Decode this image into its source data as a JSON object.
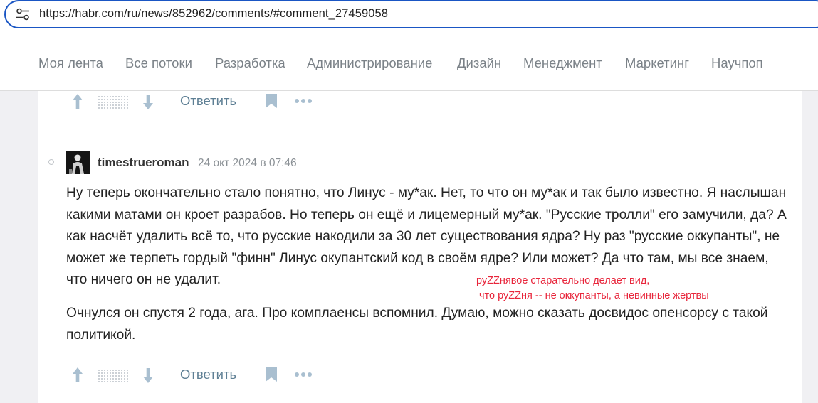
{
  "browser": {
    "url": "https://habr.com/ru/news/852962/comments/#comment_27459058",
    "site_info_icon": "tune-icon"
  },
  "nav": {
    "items": [
      {
        "label": "Моя лента"
      },
      {
        "label": "Все потоки"
      },
      {
        "label": "Разработка"
      },
      {
        "label": "Администрирование"
      },
      {
        "label": "Дизайн"
      },
      {
        "label": "Менеджмент"
      },
      {
        "label": "Маркетинг"
      },
      {
        "label": "Научпоп"
      }
    ]
  },
  "prev_comment_actions": {
    "reply_label": "Ответить",
    "icons": [
      "arrow-up-icon",
      "score-placeholder",
      "arrow-down-icon",
      "bookmark-icon",
      "more-icon"
    ]
  },
  "comment": {
    "author": "timestrueroman",
    "timestamp": "24 окт 2024 в 07:46",
    "paragraph1": "Ну теперь окончательно стало понятно, что Линус - му*ак. Нет, то что он му*ак и так было известно. Я наслышан какими матами он кроет разрабов. Но теперь он ещё и лицемерный му*ак. \"Русские тролли\" его замучили, да? А как насчёт удалить всё то, что русские накодили за 30 лет существования ядра? Ну раз \"русские оккупанты\", не может же терпеть гордый \"финн\" Линус окупантский код в своём ядре? Или может? Да что там, мы все знаем, что ничего он не удалит.",
    "paragraph2": "Очнулся он спустя 2 года, ага. Про комплаенсы вспомнил. Думаю, можно сказать досвидос опенсорсу с такой политикой.",
    "actions": {
      "reply_label": "Ответить"
    }
  },
  "annotation": {
    "line1": "руZZнявое старательно делает вид,",
    "line2": "что руZZня -- не оккупанты, а невинные жертвы",
    "color": "#e8253b"
  },
  "colors": {
    "link_blue": "#5e7f94",
    "nav_text": "#7b8288",
    "page_bg": "#f0f0f3"
  }
}
